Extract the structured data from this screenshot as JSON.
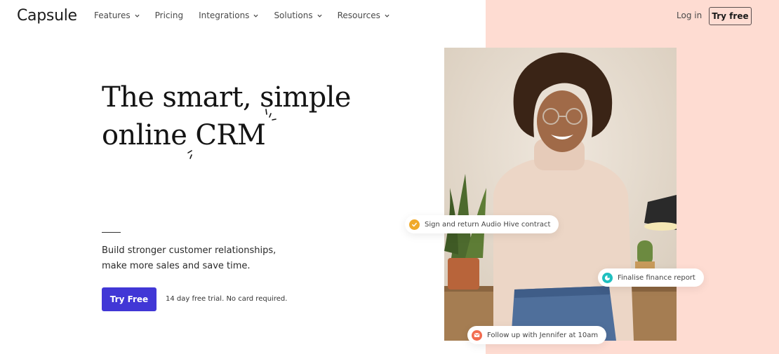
{
  "brand": {
    "name": "Capsule"
  },
  "nav": {
    "items": [
      {
        "label": "Features",
        "has_dropdown": true
      },
      {
        "label": "Pricing",
        "has_dropdown": false
      },
      {
        "label": "Integrations",
        "has_dropdown": true
      },
      {
        "label": "Solutions",
        "has_dropdown": true
      },
      {
        "label": "Resources",
        "has_dropdown": true
      }
    ],
    "login_label": "Log in",
    "try_free_label": "Try free"
  },
  "hero": {
    "headline_line1": "The smart, simple",
    "headline_line2_prefix": "online",
    "headline_highlight": "CRM",
    "subtext": "Build stronger customer relationships, make more sales and save time.",
    "cta_label": "Try Free",
    "trial_note": "14 day free trial. No card required."
  },
  "tasks": [
    {
      "label": "Sign and return Audio Hive contract",
      "icon": "check-icon",
      "color": "#f0a929"
    },
    {
      "label": "Finalise finance report",
      "icon": "pie-chart-icon",
      "color": "#1fbfbf"
    },
    {
      "label": "Follow up with Jennifer at 10am",
      "icon": "mail-icon",
      "color": "#f26b4f"
    }
  ],
  "colors": {
    "accent": "#4137d6",
    "panel": "#fedcd2"
  }
}
